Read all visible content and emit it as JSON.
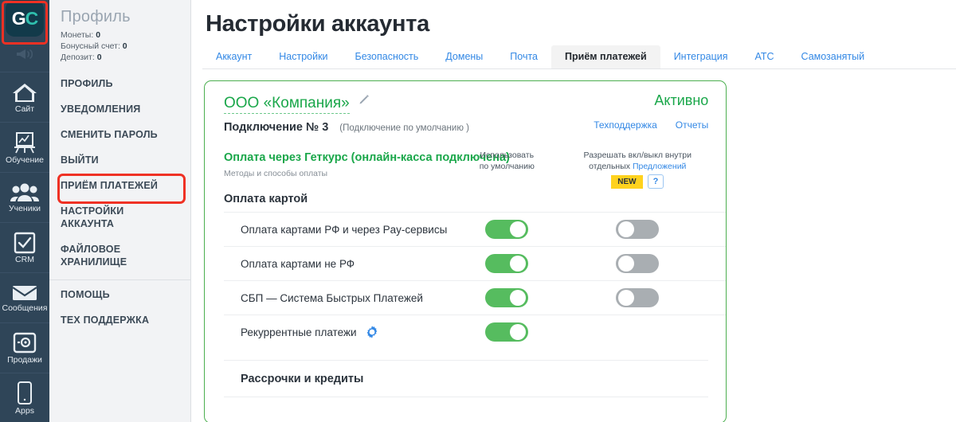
{
  "brand": {
    "logo_text_1": "G",
    "logo_text_2": "C",
    "logo_color": "#123a4a",
    "accent_teal": "#2fc0ae"
  },
  "rail": {
    "items": [
      {
        "label": "",
        "icon": "megaphone-icon"
      },
      {
        "label": "Сайт",
        "icon": "home-icon"
      },
      {
        "label": "Обучение",
        "icon": "chart-easel-icon"
      },
      {
        "label": "Ученики",
        "icon": "people-icon"
      },
      {
        "label": "CRM",
        "icon": "checkbox-icon"
      },
      {
        "label": "Сообщения",
        "icon": "envelope-icon"
      },
      {
        "label": "Продажи",
        "icon": "safe-icon"
      },
      {
        "label": "Apps",
        "icon": "phone-icon"
      }
    ]
  },
  "nav": {
    "profile_title": "Профиль",
    "stats": [
      {
        "label": "Монеты:",
        "value": "0"
      },
      {
        "label": "Бонусный счет:",
        "value": "0"
      },
      {
        "label": "Депозит:",
        "value": "0"
      }
    ],
    "items": [
      "ПРОФИЛЬ",
      "УВЕДОМЛЕНИЯ",
      "СМЕНИТЬ ПАРОЛЬ",
      "ВЫЙТИ",
      "ПРИЁМ ПЛАТЕЖЕЙ",
      "НАСТРОЙКИ АККАУНТА",
      "ФАЙЛОВОЕ ХРАНИЛИЩЕ"
    ],
    "items_bottom": [
      "ПОМОЩЬ",
      "ТЕХ ПОДДЕРЖКА"
    ],
    "highlight_color": "#ef3124"
  },
  "header": {
    "title": "Настройки аккаунта",
    "tabs": [
      {
        "label": "Аккаунт",
        "active": false
      },
      {
        "label": "Настройки",
        "active": false
      },
      {
        "label": "Безопасность",
        "active": false
      },
      {
        "label": "Домены",
        "active": false
      },
      {
        "label": "Почта",
        "active": false
      },
      {
        "label": "Приём платежей",
        "active": true
      },
      {
        "label": "Интеграция",
        "active": false
      },
      {
        "label": "АТС",
        "active": false
      },
      {
        "label": "Самозанятый",
        "active": false
      }
    ]
  },
  "card": {
    "border_color": "#4caf50",
    "company": "ООО «Компания»",
    "edit_icon": "pencil-icon",
    "connection_name": "Подключение № 3",
    "connection_default": "(Подключение по умолчанию )",
    "status": "Активно",
    "status_color": "#1aa74a",
    "links": [
      "Техподдержка",
      "Отчеты"
    ],
    "section": {
      "title": "Оплата через Геткурс (онлайн-касса подключена)",
      "subtitle": "Методы и способы оплаты",
      "group_title": "Оплата картой",
      "group_title_2": "Рассрочки и кредиты"
    },
    "columns": {
      "use_default_line1": "Использовать",
      "use_default_line2": "по умолчанию",
      "allow_line1": "Разрешать вкл/выкл внутри",
      "allow_line2_prefix": "отдельных",
      "allow_line2_link": "Предложений",
      "badge_new": "NEW",
      "badge_help": "?",
      "badge_new_color": "#ffd21e"
    },
    "rows": [
      {
        "label": "Оплата картами РФ и через Pay-сервисы",
        "use_default": "on",
        "allow_toggle": "off",
        "gear": false
      },
      {
        "label": "Оплата картами не РФ",
        "use_default": "on",
        "allow_toggle": "off",
        "gear": false
      },
      {
        "label": "СБП — Система Быстрых Платежей",
        "use_default": "on",
        "allow_toggle": "off",
        "gear": false
      },
      {
        "label": "Рекуррентные платежи",
        "use_default": "on",
        "allow_toggle": null,
        "gear": true
      }
    ]
  }
}
